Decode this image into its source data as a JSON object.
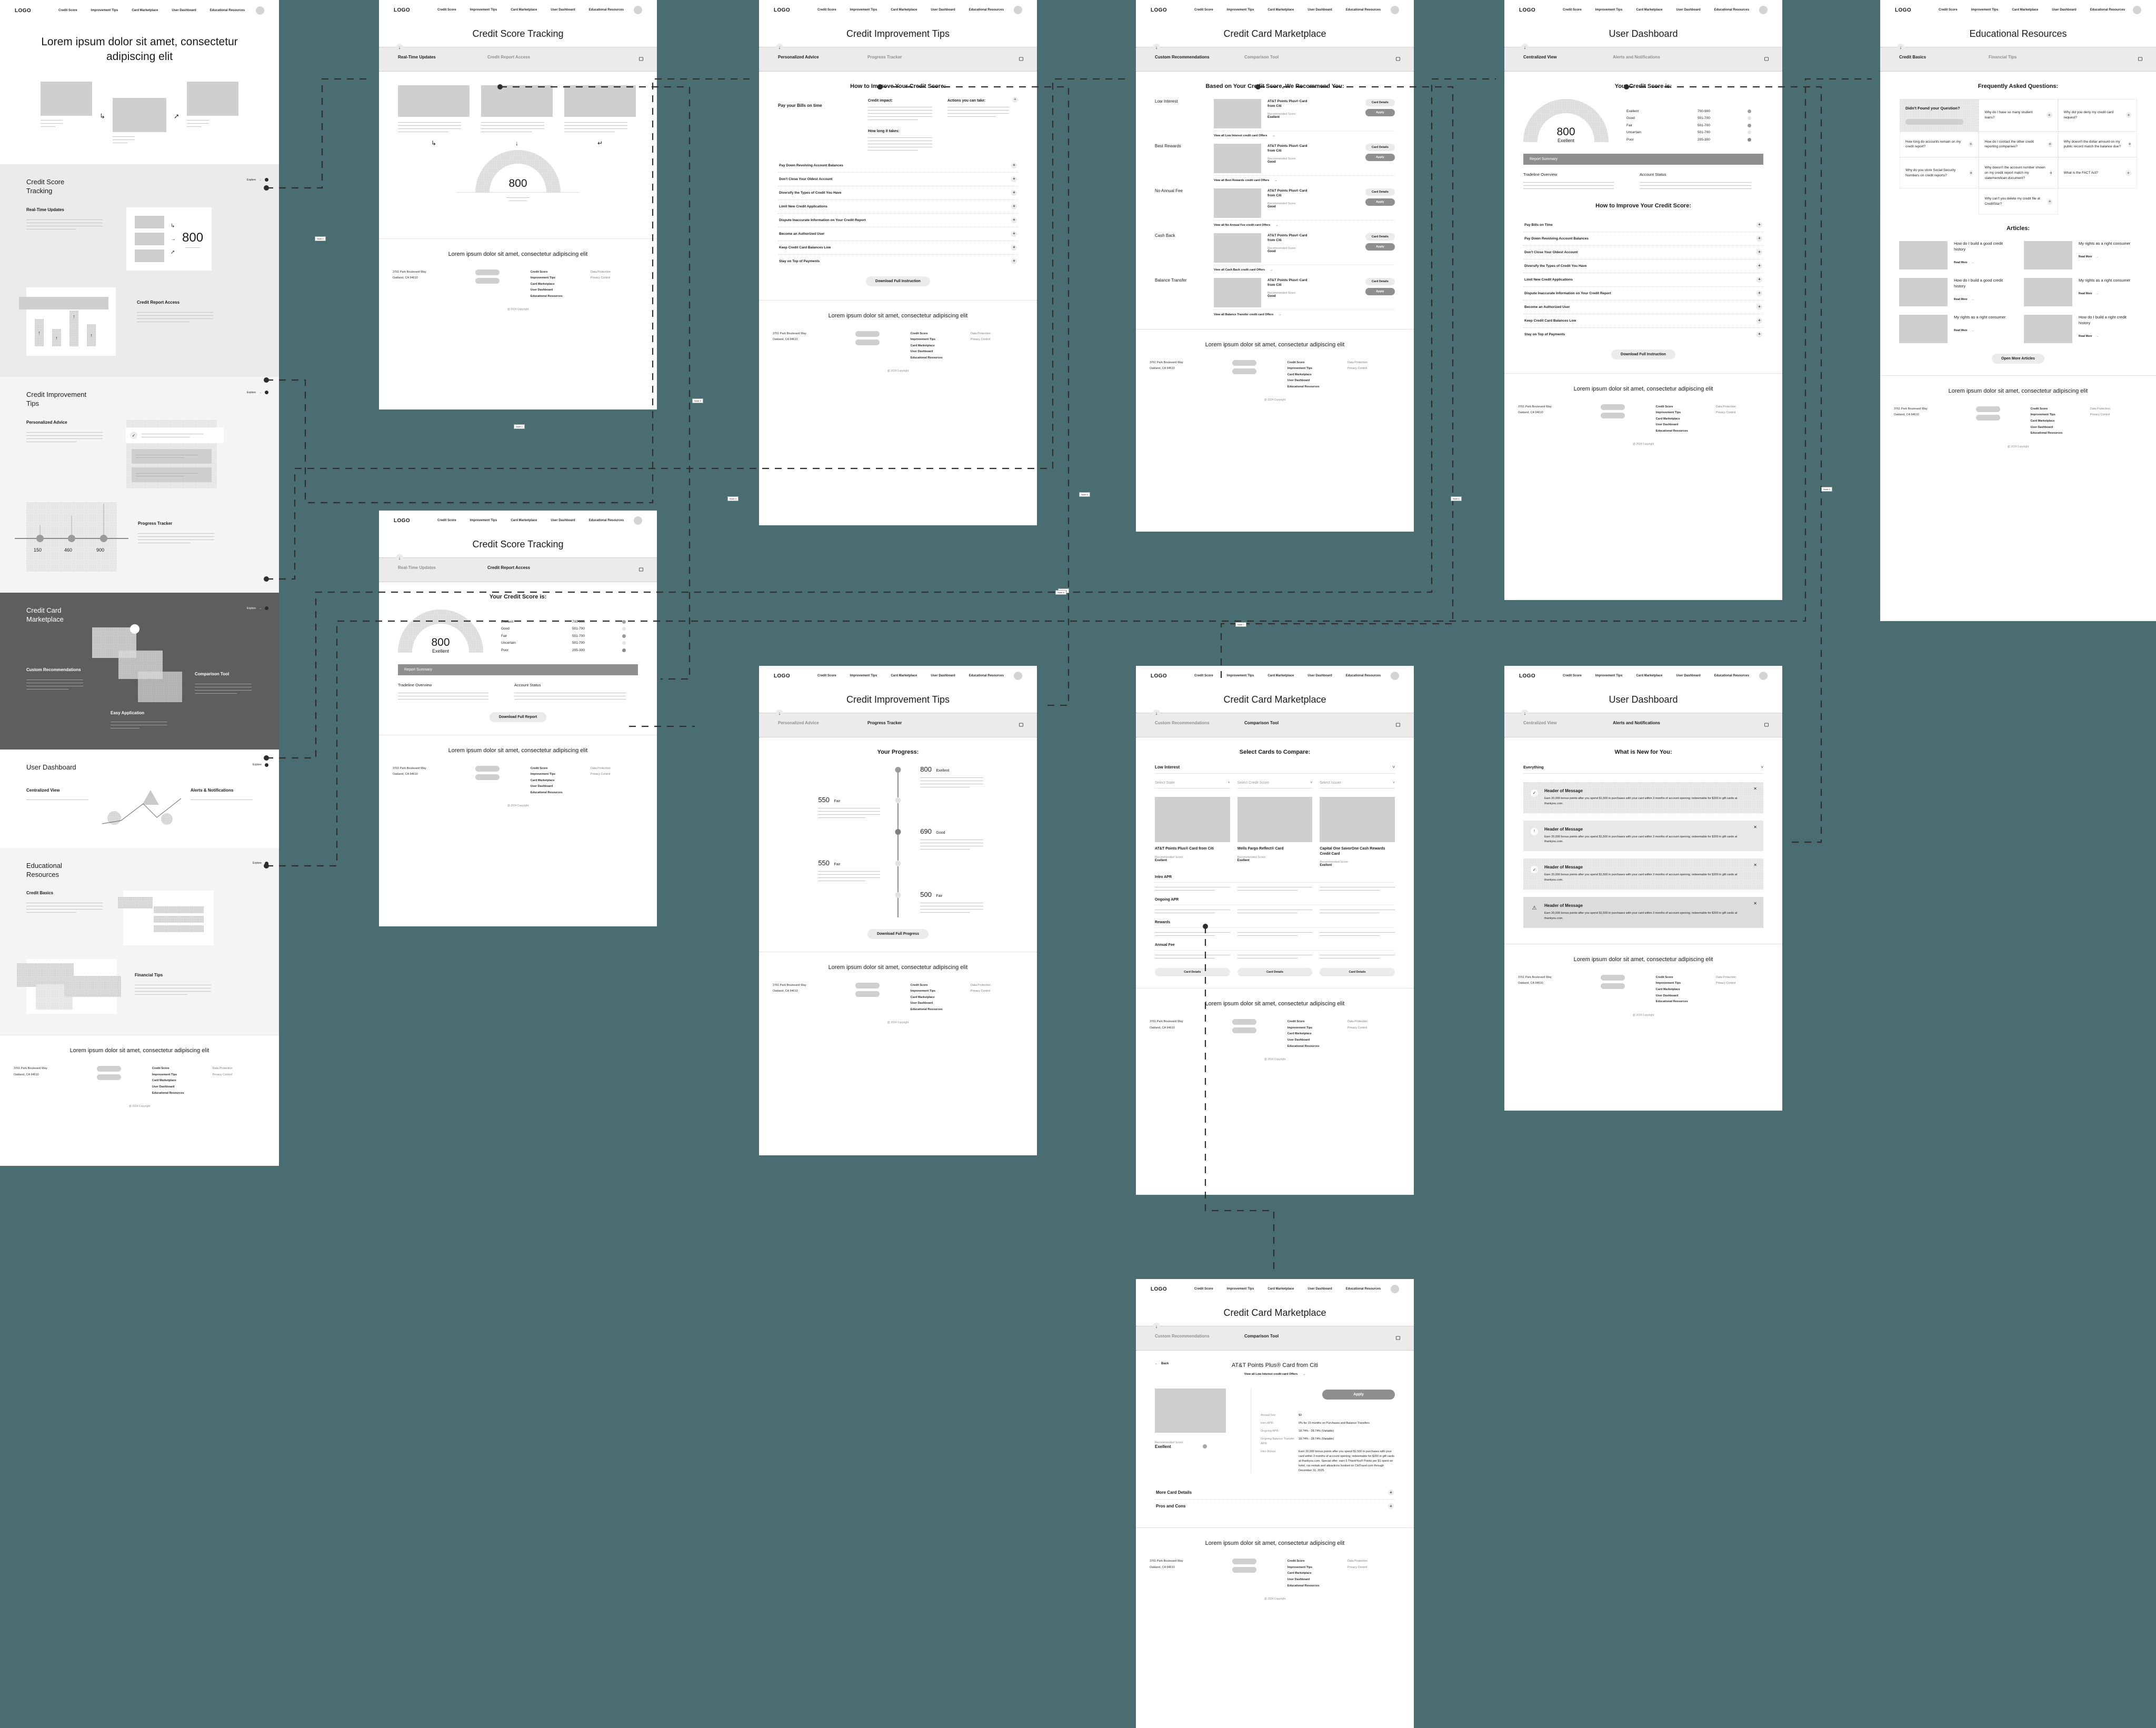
{
  "brand": {
    "logo": "LOGO"
  },
  "nav": {
    "items": [
      "Credit Score",
      "Improvement Tips",
      "Card Marketplace",
      "User Dashboard",
      "Educational Resources"
    ]
  },
  "hero": {
    "headline": "Lorem ipsum dolor sit amet, consectetur adipiscing elit"
  },
  "explore_label": "Explore",
  "landing_sections": [
    {
      "title": "Credit Score Tracking",
      "left_label": "Real-Time Updates",
      "right_label": "Credit Report Access",
      "score": "800"
    },
    {
      "title": "Credit Improvement Tips",
      "left_label": "Personalized Advice",
      "right_label": "Progress Tracker",
      "slider_ticks": [
        "150",
        "460",
        "900"
      ]
    },
    {
      "title": "Credit Card Marketplace",
      "left_label": "Custom Recommendations",
      "right_label": "Comparison Tool",
      "center_label": "Easy Application"
    },
    {
      "title": "User Dashboard",
      "left_label": "Centralized View",
      "right_label": "Alerts & Notifications"
    },
    {
      "title": "Educational Resources",
      "left_label": "Credit Basics",
      "right_label": "Financial Tips"
    }
  ],
  "footer": {
    "headline": "Lorem ipsum dolor sit amet, consectetur adipiscing elit",
    "address_line1": "3761 Park Boulevard Way",
    "address_line2": "Oakland, CA 94610",
    "links": [
      "Credit Score",
      "Improvement Tips",
      "Card Marketplace",
      "User Dashboard",
      "Educational Resources"
    ],
    "legal": [
      "Data Protection",
      "Privacy Control"
    ],
    "copyright": "@ 2024 Copyright"
  },
  "screens": {
    "credit_score_tracking": {
      "title": "Credit Score Tracking",
      "tabs": [
        "Real-Time Updates",
        "Credit Report Access"
      ],
      "active_tab": 0,
      "score": "800"
    },
    "credit_report_access": {
      "title": "Credit Score Tracking",
      "tabs": [
        "Real-Time Updates",
        "Credit Report Access"
      ],
      "active_tab": 1,
      "section_heading": "Your Credit Score is:",
      "score": "800",
      "score_label": "Exellent",
      "bands": [
        {
          "name": "Exellent",
          "range": "700-900",
          "color": "#a0a0a0"
        },
        {
          "name": "Good",
          "range": "501-700",
          "color": "#e4e4e4"
        },
        {
          "name": "Fair",
          "range": "501-700",
          "color": "#9a9a9a"
        },
        {
          "name": "Uncertain",
          "range": "501-700",
          "color": "#e4e4e4"
        },
        {
          "name": "Poor",
          "range": "205-300",
          "color": "#8a8a8a"
        }
      ],
      "report_summary_title": "Report Summary",
      "summary_cols": [
        "Tradeline Overview",
        "Account Status"
      ],
      "cta": "Download Full Report"
    },
    "credit_improvement_tips": {
      "title": "Credit Improvement Tips",
      "tabs": [
        "Personalized Advice",
        "Progress Tracker"
      ],
      "active_tab": 0,
      "section_heading": "How to Improve Your Credit Score:",
      "featured_tip": "Pay your Bills on time",
      "featured_cols": [
        "Credit impact:",
        "Actions you can take:",
        "How long it takes:"
      ],
      "tips": [
        "Pay Down Revolving Account Balances",
        "Don't Close Your Oldest Account",
        "Diversify the Types of Credit You Have",
        "Limit New Credit Applications",
        "Dispute Inaccurate Information on Your Credit Report",
        "Become an Authorized User",
        "Keep Credit Card Balances Low",
        "Stay on Top of Payments"
      ],
      "cta": "Download Full Instruction"
    },
    "progress_tracker": {
      "title": "Credit Improvement Tips",
      "tabs": [
        "Personalized Advice",
        "Progress Tracker"
      ],
      "active_tab": 1,
      "section_heading": "Your Progress:",
      "milestones": [
        {
          "score": "800",
          "label": "Exellent",
          "side": "right"
        },
        {
          "score": "550",
          "label": "Fair",
          "side": "left"
        },
        {
          "score": "690",
          "label": "Good",
          "side": "right"
        },
        {
          "score": "550",
          "label": "Fair",
          "side": "left"
        },
        {
          "score": "500",
          "label": "Fair",
          "side": "right"
        }
      ],
      "cta": "Download Full Progress"
    },
    "card_marketplace": {
      "title": "Credit Card Marketplace",
      "tabs": [
        "Custom Recommendations",
        "Comparison Tool"
      ],
      "active_tab": 0,
      "section_heading": "Based on Your Credit Score, We Recommend You:",
      "categories": [
        {
          "name": "Low Interest",
          "card": "AT&T Points Plus® Card from Citi",
          "rec_label": "Recommended Score:",
          "rec_value": "Exellent",
          "view_all": "View all Low Interest credit card Offers"
        },
        {
          "name": "Best Rewards",
          "card": "AT&T Points Plus® Card from Citi",
          "rec_label": "Recommended Score:",
          "rec_value": "Good",
          "view_all": "View all Best Rewards credit card Offers"
        },
        {
          "name": "No Annual Fee",
          "card": "AT&T Points Plus® Card from Citi",
          "rec_label": "Recommended Score:",
          "rec_value": "Good",
          "view_all": "View all No Annual Fee credit card Offers"
        },
        {
          "name": "Cash Back",
          "card": "AT&T Points Plus® Card from Citi",
          "rec_label": "Recommended Score:",
          "rec_value": "Good",
          "view_all": "View all Cash Back credit card Offers"
        },
        {
          "name": "Balance Transfer",
          "card": "AT&T Points Plus® Card from Citi",
          "rec_label": "Recommended Score:",
          "rec_value": "Good",
          "view_all": "View all Balance Transfer credit card Offers"
        }
      ],
      "btn_details": "Card Details",
      "btn_apply": "Apply"
    },
    "comparison_tool": {
      "title": "Credit Card Marketplace",
      "tabs": [
        "Custom Recommendations",
        "Comparison Tool"
      ],
      "active_tab": 1,
      "section_heading": "Select Cards to Compare:",
      "category_select": "Low Interest",
      "filters": [
        "Select State",
        "Select Credit Score",
        "Select Issuer"
      ],
      "cards": [
        {
          "name": "AT&T Points Plus® Card from Citi",
          "rec_label": "Recommended Score:",
          "rec_value": "Exellent"
        },
        {
          "name": "Wells Fargo Reflect® Card",
          "rec_label": "Recommended Score:",
          "rec_value": "Exellent"
        },
        {
          "name": "Capital One SavorOne Cash Rewards Credit Card",
          "rec_label": "Recommended Score:",
          "rec_value": "Exellent"
        }
      ],
      "rows": [
        "Intro APR",
        "Ongoing APR",
        "Rewards",
        "Annual Fee"
      ],
      "btn_details": "Card Details"
    },
    "card_detail": {
      "title": "Credit Card Marketplace",
      "tabs": [
        "Custom Recommendations",
        "Comparison Tool"
      ],
      "active_tab": 1,
      "back": "Back",
      "card_name": "AT&T Points Plus® Card from Citi",
      "view_all": "View all Low Interest credit card Offers",
      "apply": "Apply",
      "rec_label": "Recommended Score:",
      "rec_value": "Exellent",
      "specs": [
        {
          "label": "Annual Fee:",
          "value": "$0"
        },
        {
          "label": "Intro APR:",
          "value": "0% for 15 months on Purchases and Balance Transfers"
        },
        {
          "label": "Ongoing APR:",
          "value": "18.74% - 28.74% (Variable)"
        },
        {
          "label": "Ongoing Balance Transfer APR:",
          "value": "18.74% - 28.74% (Variable)"
        },
        {
          "label": "Intro Bonus:",
          "value": "Earn 20,000 bonus points after you spend $1,500 in purchases with your card within 3 months of account opening; redeemable for $200 in gift cards at thankyou.com. Special offer: earn 5 ThankYou® Points per $1 spent on hotel, car rentals and attractions booked on CitiTravel.com through December 31, 2025."
        }
      ],
      "accordions": [
        "More Card Details",
        "Pros and Cons"
      ]
    },
    "user_dashboard": {
      "title": "User Dashboard",
      "tabs": [
        "Centralized View",
        "Alerts and Notifications"
      ],
      "active_tab": 0,
      "section_heading": "Your Credit Score is:",
      "score": "800",
      "score_label": "Exellent",
      "bands": [
        {
          "name": "Exellent",
          "range": "700-900",
          "color": "#a0a0a0"
        },
        {
          "name": "Good",
          "range": "501-700",
          "color": "#e4e4e4"
        },
        {
          "name": "Fair",
          "range": "501-700",
          "color": "#9a9a9a"
        },
        {
          "name": "Uncertain",
          "range": "501-700",
          "color": "#e4e4e4"
        },
        {
          "name": "Poor",
          "range": "205-300",
          "color": "#8a8a8a"
        }
      ],
      "report_summary_title": "Report Summary",
      "summary_cols": [
        "Tradeline Overview",
        "Account Status"
      ],
      "improve_heading": "How to Improve Your Credit Score:",
      "tips": [
        "Pay Bills on Time",
        "Pay Down Revolving Account Balances",
        "Don't Close Your Oldest Account",
        "Diversify the Types of Credit You Have",
        "Limit New Credit Applications",
        "Dispute Inaccurate Information on Your Credit Report",
        "Become an Authorized User",
        "Keep Credit Card Balances Low",
        "Stay on Top of Payments"
      ],
      "cta": "Download Full Instruction"
    },
    "alerts_notifications": {
      "title": "User Dashboard",
      "tabs": [
        "Centralized View",
        "Alerts and Notifications"
      ],
      "active_tab": 1,
      "section_heading": "What is New for You:",
      "filter": "Everything",
      "messages": [
        {
          "icon": "check-icon",
          "header": "Header of Message",
          "body": "Earn 20,000 bonus points after you spend $1,500 in purchases with your card within 3 months of account opening; redeemable for $200 in gift cards at thankyou.com."
        },
        {
          "icon": "info-icon",
          "header": "Header of Message",
          "body": "Earn 20,000 bonus points after you spend $1,500 in purchases with your card within 3 months of account opening; redeemable for $200 in gift cards at thankyou.com."
        },
        {
          "icon": "check-icon",
          "header": "Header of Message",
          "body": "Earn 20,000 bonus points after you spend $1,500 in purchases with your card within 3 months of account opening; redeemable for $200 in gift cards at thankyou.com."
        },
        {
          "icon": "warning-icon",
          "header": "Header of Message",
          "body": "Earn 20,000 bonus points after you spend $1,500 in purchases with your card within 3 months of account opening; redeemable for $200 in gift cards at thankyou.com."
        }
      ]
    },
    "educational_resources": {
      "title": "Educational Resources",
      "tabs": [
        "Credit Basics",
        "Financial Tips"
      ],
      "active_tab": 0,
      "faq_heading": "Frequently Asked Questions:",
      "not_found_title": "Didn't Found your Question?",
      "faqs": [
        "Why do I have so many student loans?",
        "Why did you deny my credit card request?",
        "How long do accounts remain on my credit report?",
        "How do I contact the other credit reporting companies?",
        "Why doesn't the dollar amount on my public record match the balance due?",
        "Why do you store Social Security Numbers on credit reports?",
        "Why doesn't the account number shown on my credit report match my statement/loan document?",
        "What is the FACT Act?",
        "Why can't you delete my credit file at CreditStar?"
      ],
      "articles_heading": "Articles:",
      "articles": [
        {
          "title": "How do I build a good credit history",
          "cta": "Read More"
        },
        {
          "title": "My rights as a right consumer",
          "cta": "Read More"
        },
        {
          "title": "How do I build a good credit history",
          "cta": "Read More"
        },
        {
          "title": "My rights as a right consumer",
          "cta": "Read More"
        },
        {
          "title": "My rights as a right consumer",
          "cta": "Read More"
        },
        {
          "title": "How do I build a right credit history",
          "cta": "Read More"
        }
      ],
      "more_articles_cta": "Open More Articles"
    }
  },
  "flow_labels": [
    "Node 1",
    "Node 2",
    "Node 3",
    "Node 4",
    "Node 5",
    "Node 6",
    "Node 7",
    "Node 8"
  ],
  "colors": {
    "canvas": "#4a6d72",
    "panel_dark": "#5e5e5e",
    "panel_grey": "#ebebeb",
    "panel_light": "#f4f4f4"
  }
}
